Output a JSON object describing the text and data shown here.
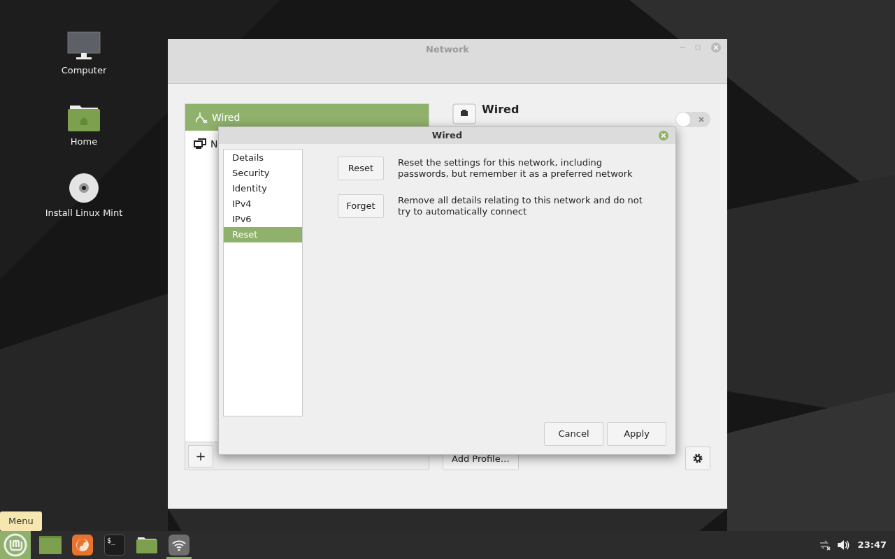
{
  "desktop_icons": [
    {
      "kind": "computer",
      "label": "Computer"
    },
    {
      "kind": "home",
      "label": "Home"
    },
    {
      "kind": "disc",
      "label": "Install Linux Mint"
    }
  ],
  "network_window": {
    "title": "Network",
    "devices": [
      {
        "kind": "wired",
        "label": "Wired",
        "selected": true
      },
      {
        "kind": "network",
        "label": "N",
        "selected": false
      }
    ],
    "detail": {
      "title": "Wired",
      "on": false
    },
    "add_profile": "Add Profile…",
    "add": "+"
  },
  "dialog": {
    "title": "Wired",
    "nav": [
      {
        "label": "Details",
        "selected": false
      },
      {
        "label": "Security",
        "selected": false
      },
      {
        "label": "Identity",
        "selected": false
      },
      {
        "label": "IPv4",
        "selected": false
      },
      {
        "label": "IPv6",
        "selected": false
      },
      {
        "label": "Reset",
        "selected": true
      }
    ],
    "actions": [
      {
        "button": "Reset",
        "description": "Reset the settings for this network, including passwords, but remember it as a preferred network"
      },
      {
        "button": "Forget",
        "description": "Remove all details relating to this network and do not try to automatically connect"
      }
    ],
    "buttons": [
      "Cancel",
      "Apply"
    ]
  },
  "taskbar": {
    "tooltip": "Menu",
    "apps": [
      {
        "kind": "menu",
        "active": false
      },
      {
        "kind": "desktop",
        "active": false
      },
      {
        "kind": "firefox",
        "active": false
      },
      {
        "kind": "terminal",
        "label": "$_",
        "active": false
      },
      {
        "kind": "folder",
        "active": false
      },
      {
        "kind": "network",
        "active": true
      }
    ],
    "clock": "23:47"
  }
}
